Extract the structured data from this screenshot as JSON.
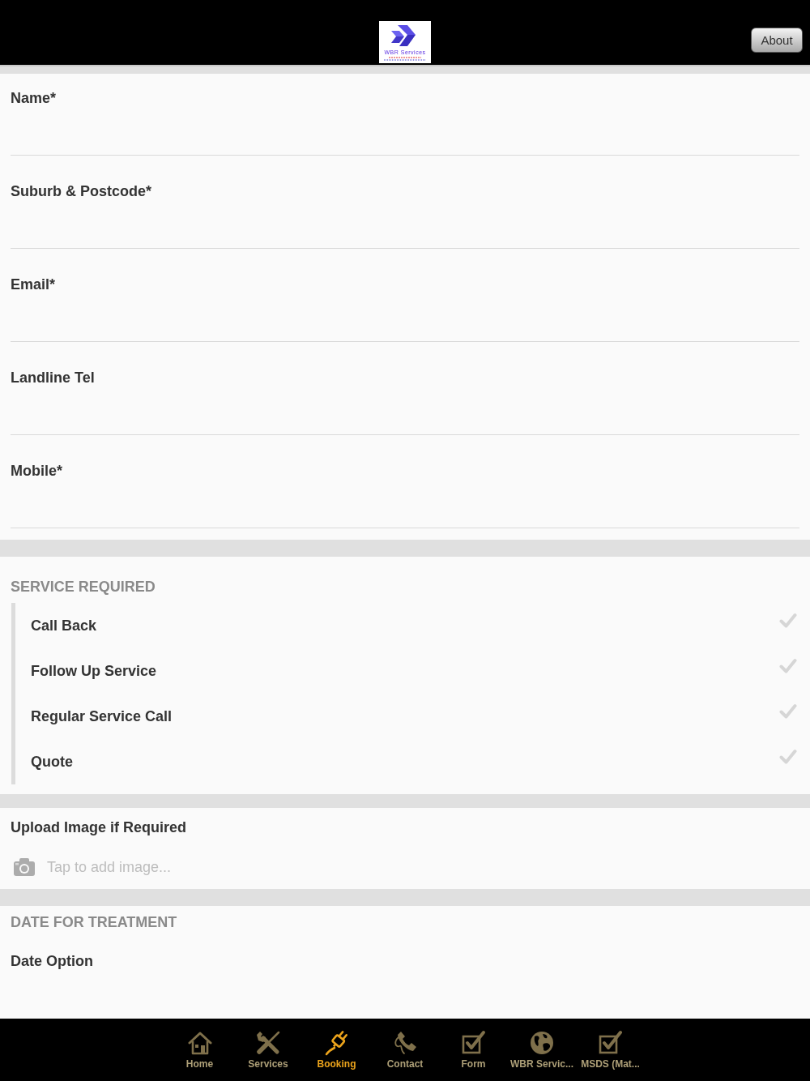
{
  "header": {
    "logo_text": "WBR Services",
    "about_button": "About"
  },
  "fields": [
    {
      "label": "Name*"
    },
    {
      "label": "Suburb & Postcode*"
    },
    {
      "label": "Email*"
    },
    {
      "label": "Landline Tel"
    },
    {
      "label": "Mobile*"
    }
  ],
  "service_required": {
    "heading": "SERVICE REQUIRED",
    "options": [
      {
        "label": "Call Back",
        "checked": false
      },
      {
        "label": "Follow Up Service",
        "checked": false
      },
      {
        "label": "Regular Service Call",
        "checked": false
      },
      {
        "label": "Quote",
        "checked": false
      }
    ]
  },
  "upload": {
    "label": "Upload Image if Required",
    "placeholder": "Tap to add image..."
  },
  "date_section": {
    "heading": "DATE FOR TREATMENT",
    "field_label": "Date Option"
  },
  "tab_bar": [
    {
      "label": "Home",
      "kind": "home",
      "selected": false
    },
    {
      "label": "Services",
      "kind": "tools",
      "selected": false
    },
    {
      "label": "Booking",
      "kind": "plug",
      "selected": true
    },
    {
      "label": "Contact",
      "kind": "phone",
      "selected": false
    },
    {
      "label": "Form",
      "kind": "checkbox",
      "selected": false
    },
    {
      "label": "WBR Servic...",
      "kind": "globe",
      "selected": false
    },
    {
      "label": "MSDS (Mat...",
      "kind": "checkbox",
      "selected": false
    }
  ]
}
